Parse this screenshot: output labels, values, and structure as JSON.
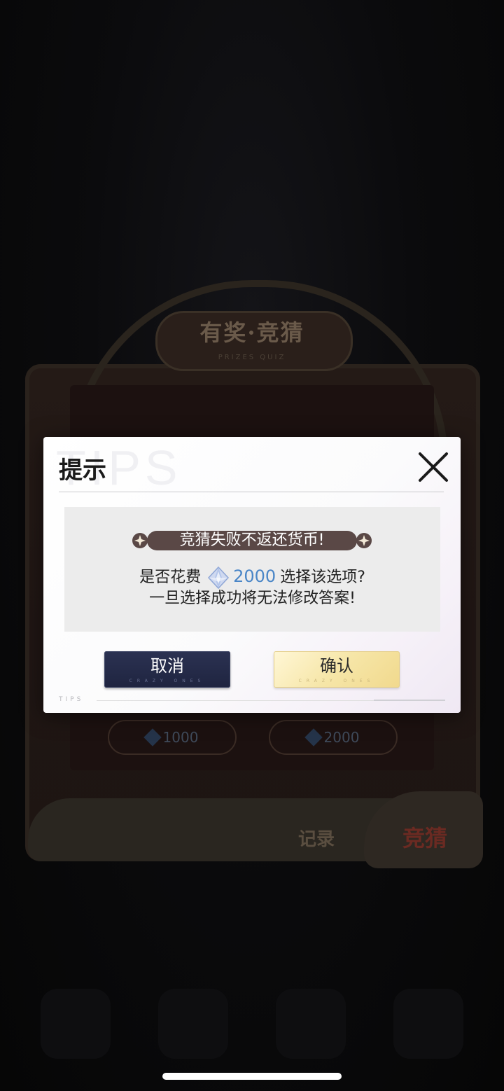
{
  "background": {
    "title": "有奖·竞猜",
    "subtitle": "PRIZES QUIZ",
    "options": [
      {
        "amount": "1000"
      },
      {
        "amount": "2000"
      }
    ],
    "tabs": {
      "record": "记录",
      "guess": "竞猜"
    }
  },
  "dialog": {
    "watermark": "TIPS",
    "title": "提示",
    "banner": "竞猜失败不返还货币!",
    "line1_prefix": "是否花费",
    "line1_amount": "2000",
    "line1_suffix": "选择该选项?",
    "line2": "一旦选择成功将无法修改答案!",
    "cancel_label": "取消",
    "confirm_label": "确认",
    "button_sub": "CRAZY ONES",
    "footer": "TIPS"
  },
  "colors": {
    "amount": "#4a86c7",
    "banner": "#5a4846",
    "cancel_bg": "#262c4a",
    "confirm_bg": "#f6e6a8"
  },
  "icons": {
    "close": "close-icon",
    "gem": "diamond-gem-icon"
  }
}
